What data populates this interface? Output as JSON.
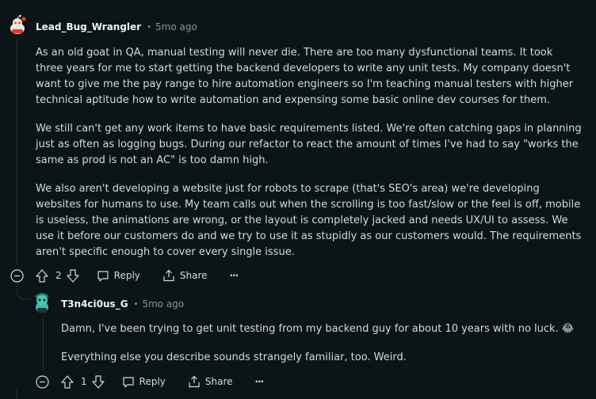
{
  "comment1": {
    "username": "Lead_Bug_Wrangler",
    "age": "5mo ago",
    "paragraphs": [
      "As an old goat in QA, manual testing will never die. There are too many dysfunctional teams. It took three years for me to start getting the backend developers to write any unit tests. My company doesn't want to give me the pay range to hire automation engineers so I'm teaching manual testers with higher technical aptitude how to write automation and expensing some basic online dev courses for them.",
      "We still can't get any work items to have basic requirements listed. We're often catching gaps in planning just as often as logging bugs. During our refactor to react the amount of times I've had to say \"works the same as prod is not an AC\" is too damn high.",
      "We also aren't developing a website just for robots to scrape (that's SEO's area) we're developing websites for humans to use. My team calls out when the scrolling is too fast/slow or the feel is off, mobile is useless, the animations are wrong, or the layout is completely jacked and needs UX/UI to assess. We use it before our customers do and we try to use it as stupidly as our customers would. The requirements aren't specific enough to cover every single issue."
    ],
    "votes": "2",
    "reply_label": "Reply",
    "share_label": "Share",
    "more_label": "···"
  },
  "comment2": {
    "username": "T3n4ci0us_G",
    "age": "5mo ago",
    "paragraphs": [
      "Damn, I've been trying to get unit testing from my backend guy for about 10 years with no luck. 😂",
      "Everything else you describe sounds strangely familiar, too. Weird."
    ],
    "votes": "1",
    "reply_label": "Reply",
    "share_label": "Share",
    "more_label": "···"
  },
  "meta_separator": "•",
  "icons": [
    "reddit-snoo-avatar-icon",
    "snoo-teal-avatar-icon",
    "collapse-thread-icon",
    "upvote-icon",
    "downvote-icon",
    "reply-icon",
    "share-icon",
    "more-options-icon"
  ],
  "colors": {
    "background": "#0b1416",
    "text": "#d7dadc",
    "muted": "#8b9296",
    "thread_line": "#2a3236"
  }
}
